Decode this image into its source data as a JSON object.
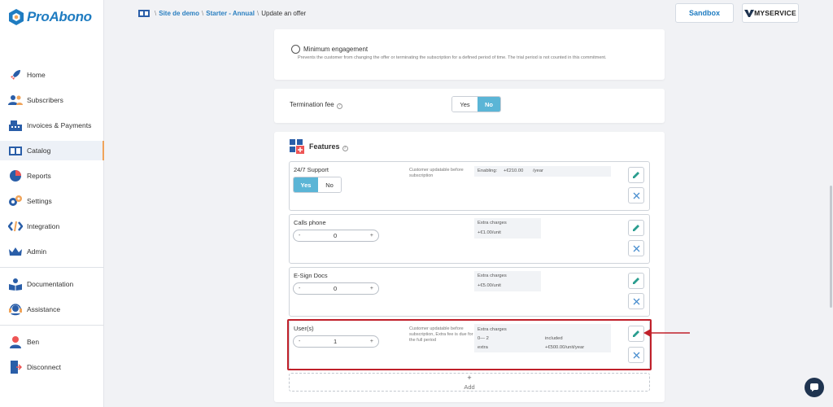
{
  "brand": {
    "name": "ProAbono",
    "color": "#1f7cc1"
  },
  "sidebar": {
    "items": [
      {
        "label": "Home",
        "icon": "rocket-icon"
      },
      {
        "label": "Subscribers",
        "icon": "users-icon"
      },
      {
        "label": "Invoices & Payments",
        "icon": "cash-register-icon"
      },
      {
        "label": "Catalog",
        "icon": "catalog-icon",
        "active": true
      },
      {
        "label": "Reports",
        "icon": "pie-chart-icon"
      },
      {
        "label": "Settings",
        "icon": "gears-icon"
      },
      {
        "label": "Integration",
        "icon": "code-icon"
      },
      {
        "label": "Admin",
        "icon": "crown-icon"
      },
      {
        "label": "Documentation",
        "icon": "book-reader-icon"
      },
      {
        "label": "Assistance",
        "icon": "headset-icon"
      },
      {
        "label": "Ben",
        "icon": "user-icon"
      },
      {
        "label": "Disconnect",
        "icon": "door-icon"
      }
    ]
  },
  "breadcrumb": {
    "items": [
      "Site de demo",
      "Starter - Annual"
    ],
    "current": "Update an offer"
  },
  "header": {
    "sandbox_label": "Sandbox",
    "tenant_logo_text": "MYSERVICE"
  },
  "engagement": {
    "title": "Minimum engagement",
    "description": "Prevents the customer from changing the offer or terminating the subscription for a defined period of time. The trial period is not counted in this commitment."
  },
  "termination": {
    "label": "Termination fee",
    "yes": "Yes",
    "no": "No",
    "selected": "No"
  },
  "features": {
    "title": "Features",
    "items": [
      {
        "name": "24/7 Support",
        "toggle": {
          "yes": "Yes",
          "no": "No",
          "selected": "Yes"
        },
        "note": "Customer updatable before subscription",
        "price_label": "Enabling:",
        "price_value": "+€210.00",
        "price_period": "/year"
      },
      {
        "name": "Calls phone",
        "stepper": {
          "minus": "-",
          "value": "0",
          "plus": "+"
        },
        "extra_label": "Extra charges",
        "extra_value": "+€1.00/unit"
      },
      {
        "name": "E-Sign Docs",
        "stepper": {
          "minus": "-",
          "value": "0",
          "plus": "+"
        },
        "extra_label": "Extra charges",
        "extra_value": "+€5.00/unit"
      },
      {
        "name": "User(s)",
        "stepper": {
          "minus": "-",
          "value": "1",
          "plus": "+"
        },
        "note": "Customer updatable before subscription, Extra fee is due for the full period",
        "extra_label": "Extra charges",
        "tiers": [
          {
            "range": "0— 2",
            "price": "included"
          },
          {
            "range": "extra",
            "price": "+€500.00/unit/year"
          }
        ]
      }
    ],
    "add_plus": "+",
    "add_label": "Add"
  },
  "colors": {
    "accent": "#5bb5d6",
    "highlight": "#c0202a",
    "edit_icon": "#2a9d8f",
    "close_icon": "#4a8fcf"
  }
}
